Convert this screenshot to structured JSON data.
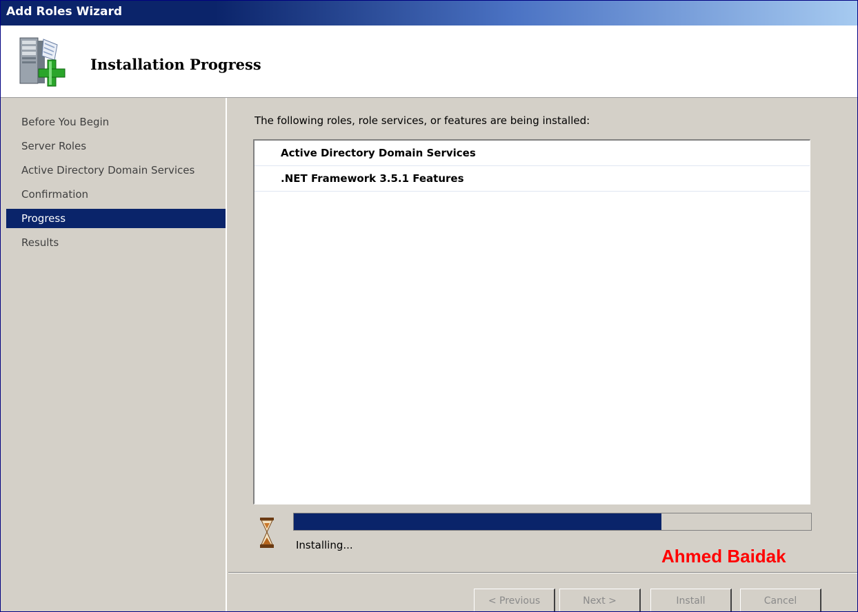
{
  "window": {
    "title": "Add Roles Wizard"
  },
  "header": {
    "page_title": "Installation Progress",
    "icon": "server-add-icon"
  },
  "nav": {
    "items": [
      {
        "label": "Before You Begin",
        "active": false
      },
      {
        "label": "Server Roles",
        "active": false
      },
      {
        "label": "Active Directory Domain Services",
        "active": false
      },
      {
        "label": "Confirmation",
        "active": false
      },
      {
        "label": "Progress",
        "active": true
      },
      {
        "label": "Results",
        "active": false
      }
    ]
  },
  "content": {
    "intro": "The following roles, role services, or features are being installed:",
    "items": [
      {
        "label": "Active Directory Domain Services"
      },
      {
        "label": ".NET Framework 3.5.1 Features"
      }
    ],
    "progress": {
      "fraction": 0.71,
      "status": "Installing...",
      "icon": "hourglass-icon"
    },
    "watermark": "Ahmed Baidak"
  },
  "buttons": {
    "previous": "< Previous",
    "next": "Next >",
    "install": "Install",
    "cancel": "Cancel"
  },
  "colors": {
    "selection": "#0a246a",
    "progress_fill": "#0a246a",
    "watermark": "#ff0000",
    "panel": "#d4d0c8"
  }
}
